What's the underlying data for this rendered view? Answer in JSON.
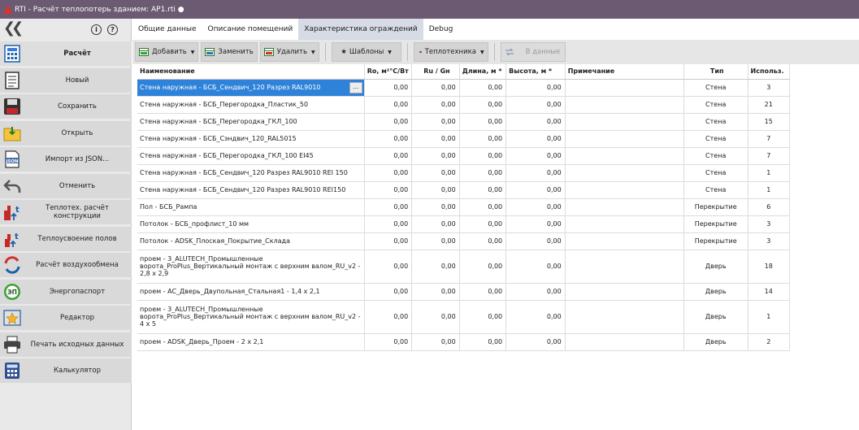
{
  "window": {
    "title": "RTI - Расчёт теплопотерь зданием: AP1.rti  ●"
  },
  "sidebar": {
    "collapse_icon": "double-chevron-left-icon",
    "items": [
      {
        "label": "Расчёт",
        "icon": "calculator-document-icon",
        "active": true
      },
      {
        "label": "Новый",
        "icon": "new-document-icon"
      },
      {
        "label": "Сохранить",
        "icon": "floppy-disk-icon"
      },
      {
        "label": "Открыть",
        "icon": "open-folder-icon"
      },
      {
        "label": "Импорт из JSON...",
        "icon": "json-file-icon"
      },
      {
        "label": "Отменить",
        "icon": "undo-arrow-icon"
      },
      {
        "label": "Теплотех. расчёт конструкции",
        "icon": "thermal-construction-icon"
      },
      {
        "label": "Теплоусвоение полов",
        "icon": "floor-heat-icon"
      },
      {
        "label": "Расчёт воздухообмена",
        "icon": "air-exchange-icon"
      },
      {
        "label": "Энергопаспорт",
        "icon": "energy-passport-icon"
      },
      {
        "label": "Редактор",
        "icon": "star-editor-icon"
      },
      {
        "label": "Печать исходных данных",
        "icon": "printer-icon"
      },
      {
        "label": "Калькулятор",
        "icon": "calculator-icon"
      }
    ]
  },
  "tabs": [
    {
      "label": "Общие данные"
    },
    {
      "label": "Описание помещений"
    },
    {
      "label": "Характеристика ограждений",
      "active": true
    },
    {
      "label": "Debug"
    }
  ],
  "toolbar": {
    "add": "Добавить",
    "replace": "Заменить",
    "delete": "Удалить",
    "templates": "Шаблоны",
    "thermal": "Теплотехника",
    "to_data": "В данные"
  },
  "table": {
    "headers": [
      "Наименование",
      "Ro, м²°С/Вт",
      "Ru / Gн",
      "Длина, м *",
      "Высота, м *",
      "Примечание",
      "Тип",
      "Использ."
    ],
    "rows": [
      {
        "name": "Стена наружная - БСБ_Сендвич_120 Разрез RAL9010",
        "ro": "0,00",
        "ru": "0,00",
        "len": "0,00",
        "h": "0,00",
        "note": "",
        "type": "Стена",
        "use": "3",
        "selected": true
      },
      {
        "name": "Стена наружная - БСБ_Перегородка_Пластик_50",
        "ro": "0,00",
        "ru": "0,00",
        "len": "0,00",
        "h": "0,00",
        "note": "",
        "type": "Стена",
        "use": "21"
      },
      {
        "name": "Стена наружная - БСБ_Перегородка_ГКЛ_100",
        "ro": "0,00",
        "ru": "0,00",
        "len": "0,00",
        "h": "0,00",
        "note": "",
        "type": "Стена",
        "use": "15"
      },
      {
        "name": "Стена наружная - БСБ_Сэндвич_120_RAL5015",
        "ro": "0,00",
        "ru": "0,00",
        "len": "0,00",
        "h": "0,00",
        "note": "",
        "type": "Стена",
        "use": "7"
      },
      {
        "name": "Стена наружная - БСБ_Перегородка_ГКЛ_100 EI45",
        "ro": "0,00",
        "ru": "0,00",
        "len": "0,00",
        "h": "0,00",
        "note": "",
        "type": "Стена",
        "use": "7"
      },
      {
        "name": "Стена наружная - БСБ_Сендвич_120 Разрез RAL9010 REI 150",
        "ro": "0,00",
        "ru": "0,00",
        "len": "0,00",
        "h": "0,00",
        "note": "",
        "type": "Стена",
        "use": "1"
      },
      {
        "name": "Стена наружная - БСБ_Сендвич_120 Разрез RAL9010 REI150",
        "ro": "0,00",
        "ru": "0,00",
        "len": "0,00",
        "h": "0,00",
        "note": "",
        "type": "Стена",
        "use": "1"
      },
      {
        "name": "Пол - БСБ_Рампа",
        "ro": "0,00",
        "ru": "0,00",
        "len": "0,00",
        "h": "0,00",
        "note": "",
        "type": "Перекрытие",
        "use": "6"
      },
      {
        "name": "Потолок - БСБ_профлист_10 мм",
        "ro": "0,00",
        "ru": "0,00",
        "len": "0,00",
        "h": "0,00",
        "note": "",
        "type": "Перекрытие",
        "use": "3"
      },
      {
        "name": "Потолок - ADSK_Плоская_Покрытие_Склада",
        "ro": "0,00",
        "ru": "0,00",
        "len": "0,00",
        "h": "0,00",
        "note": "",
        "type": "Перекрытие",
        "use": "3"
      },
      {
        "name": "проем - 3_ALUTECH_Промышленные ворота_ProPlus_Вертикальный монтаж с верхним валом_RU_v2 - 2,8 x 2,9",
        "ro": "0,00",
        "ru": "0,00",
        "len": "0,00",
        "h": "0,00",
        "note": "",
        "type": "Дверь",
        "use": "18",
        "tall": true
      },
      {
        "name": "проем - AC_Дверь_Двупольная_Стальная1 - 1,4 x 2,1",
        "ro": "0,00",
        "ru": "0,00",
        "len": "0,00",
        "h": "0,00",
        "note": "",
        "type": "Дверь",
        "use": "14"
      },
      {
        "name": "проем - 3_ALUTECH_Промышленные ворота_ProPlus_Вертикальный монтаж с верхним валом_RU_v2 - 4 x 5",
        "ro": "0,00",
        "ru": "0,00",
        "len": "0,00",
        "h": "0,00",
        "note": "",
        "type": "Дверь",
        "use": "1",
        "tall": true
      },
      {
        "name": "проем - ADSK_Дверь_Проем - 2 x 2,1",
        "ro": "0,00",
        "ru": "0,00",
        "len": "0,00",
        "h": "0,00",
        "note": "",
        "type": "Дверь",
        "use": "2"
      }
    ]
  }
}
